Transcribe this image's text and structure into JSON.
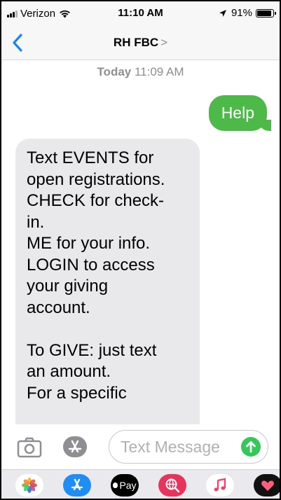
{
  "status_bar": {
    "carrier": "Verizon",
    "time": "11:10 AM",
    "battery": "91%",
    "battery_level": 0.91
  },
  "nav": {
    "title": "RH FBC",
    "chevron": ">"
  },
  "conversation": {
    "timestamp_day": "Today",
    "timestamp_time": "11:09 AM",
    "outgoing": "Help",
    "incoming": "Text EVENTS for\nopen registrations.\nCHECK for check-\nin.\nME for your info.\nLOGIN to access\nyour giving\naccount.\n\nTo GIVE: just text\nan amount.\nFor a specific"
  },
  "input": {
    "placeholder": "Text Message"
  },
  "apps": {
    "apple_pay_label": "Pay"
  },
  "colors": {
    "accent_blue": "#1a82fb",
    "bubble_green": "#4cb948",
    "bubble_gray": "#e9e9eb",
    "send_green": "#34c759"
  }
}
